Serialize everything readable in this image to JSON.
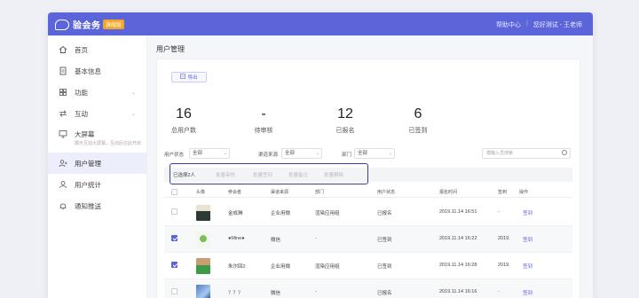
{
  "app": {
    "logo_text": "验会务",
    "edition_badge": "旗舰版",
    "help_center": "帮助中心",
    "separator": "|",
    "user": "您好测试 - 王老师"
  },
  "sidebar": {
    "items": [
      {
        "label": "首页",
        "icon": "home-icon"
      },
      {
        "label": "基本信息",
        "icon": "document-icon"
      },
      {
        "label": "功能",
        "icon": "grid-icon",
        "chevron": "⌄"
      },
      {
        "label": "互动",
        "icon": "arrows-icon",
        "chevron": "⌄"
      },
      {
        "label": "大屏幕",
        "icon": "screen-icon",
        "sub": "展示互动大屏幕，互动后在此开启"
      },
      {
        "label": "用户管理",
        "icon": "users-icon"
      },
      {
        "label": "用户统计",
        "icon": "user-stats-icon"
      },
      {
        "label": "通知推送",
        "icon": "bell-icon"
      }
    ]
  },
  "main": {
    "page_title": "用户管理",
    "export_label": "导出",
    "stats": [
      {
        "value": "16",
        "label": "总用户数"
      },
      {
        "value": "-",
        "label": "待审核"
      },
      {
        "value": "12",
        "label": "已报名"
      },
      {
        "value": "6",
        "label": "已签到"
      }
    ],
    "filters": {
      "status_label": "用户状态",
      "status_value": "全部",
      "source_label": "渠道来源",
      "source_value": "全部",
      "dept_label": "部门",
      "dept_value": "全部",
      "search_placeholder": "模糊入员搜索",
      "arrow": "⌄"
    },
    "batch": {
      "selected": "已选择2人",
      "actions": [
        "批量审核",
        "批量签到",
        "批量备注",
        "批量删除"
      ]
    },
    "table": {
      "headers": [
        "头像",
        "参会者",
        "渠道来源",
        "部门",
        "用户状态",
        "报名时间",
        "签到",
        "操作"
      ],
      "rows": [
        {
          "checked": false,
          "name": "金成琳",
          "source": "企业用微",
          "dept": "渲染应用组",
          "status": "已报名",
          "time": "2019.11.14 16:51",
          "checkin": "-",
          "action": "签到"
        },
        {
          "checked": true,
          "name": "●Mine●",
          "source": "微信",
          "dept": "-",
          "status": "已签到",
          "time": "2019.11.14 16:22",
          "checkin": "2019.",
          "action": "签到"
        },
        {
          "checked": true,
          "name": "朱尔回2",
          "source": "企业用微",
          "dept": "渲染应用组",
          "status": "已签到",
          "time": "2019.11.14 16:28",
          "checkin": "2019.",
          "action": "签到"
        },
        {
          "checked": false,
          "name": "？？？",
          "source": "微信",
          "dept": "-",
          "status": "已报名",
          "time": "2019.11.14 16:16",
          "checkin": "-",
          "action": "签到"
        }
      ]
    }
  },
  "colors": {
    "primary": "#5b64d8",
    "highlight_border": "#3c3ea0",
    "badge": "#f5a623"
  }
}
